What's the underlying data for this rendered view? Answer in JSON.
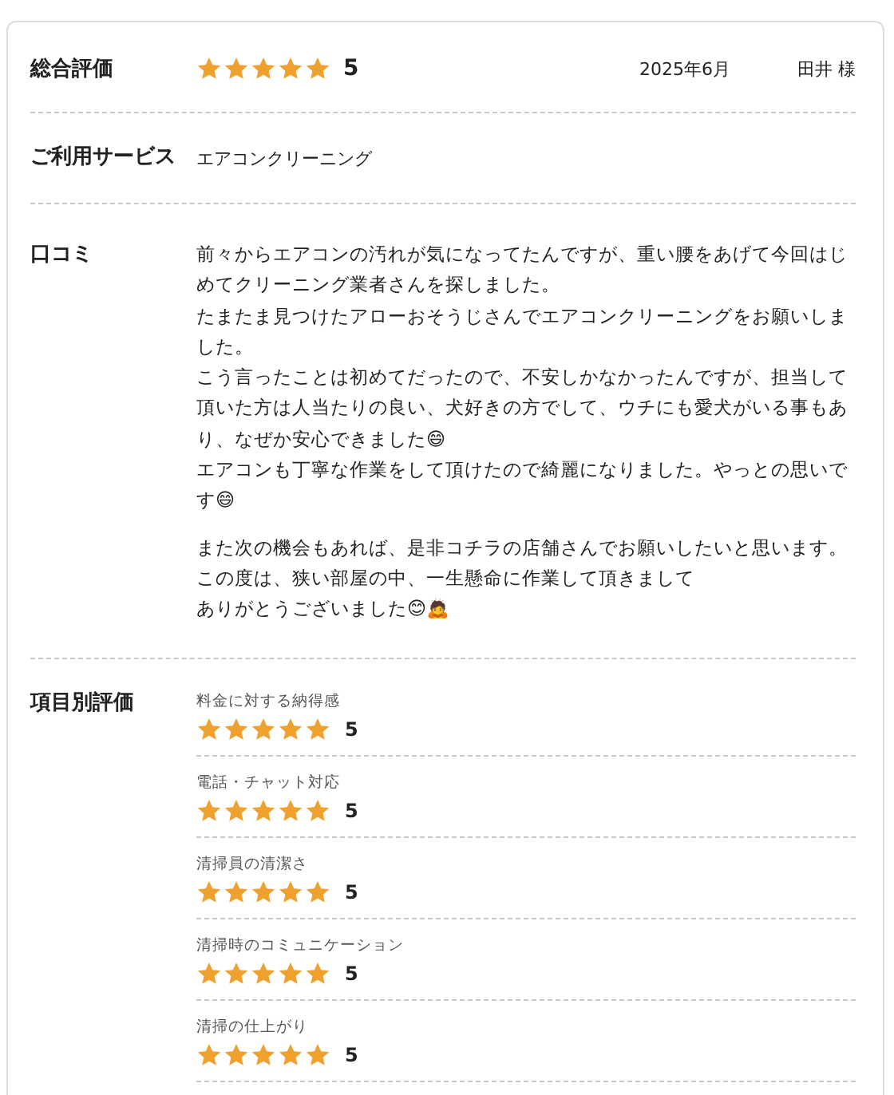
{
  "overall": {
    "label": "総合評価",
    "stars": 5,
    "score": "5",
    "date": "2025年6月",
    "reviewer": "田井 様"
  },
  "service": {
    "label": "ご利用サービス",
    "value": "エアコンクリーニング"
  },
  "review": {
    "label": "口コミ",
    "paragraphs": [
      {
        "lines": [
          "前々からエアコンの汚れが気になってたんですが、重い腰をあげて今回はじめてクリーニング業者さんを探しました。",
          "たまたま見つけたアローおそうじさんでエアコンクリーニングをお願いしました。",
          "こう言ったことは初めてだったので、不安しかなかったんですが、担当して頂いた方は人当たりの良い、犬好きの方でして、ウチにも愛犬がいる事もあり、なぜか安心できました😄",
          "エアコンも丁寧な作業をして頂けたので綺麗になりました。やっとの思いです😄"
        ]
      },
      {
        "lines": [
          "また次の機会もあれば、是非コチラの店舗さんでお願いしたいと思います。",
          "この度は、狭い部屋の中、一生懸命に作業して頂きまして",
          "ありがとうございました😊🙇"
        ]
      }
    ]
  },
  "items": {
    "label": "項目別評価",
    "ratings": [
      {
        "name": "料金に対する納得感",
        "stars": 5,
        "score": "5"
      },
      {
        "name": "電話・チャット対応",
        "stars": 5,
        "score": "5"
      },
      {
        "name": "清掃員の清潔さ",
        "stars": 5,
        "score": "5"
      },
      {
        "name": "清掃時のコミュニケーション",
        "stars": 5,
        "score": "5"
      },
      {
        "name": "清掃の仕上がり",
        "stars": 5,
        "score": "5"
      }
    ]
  }
}
